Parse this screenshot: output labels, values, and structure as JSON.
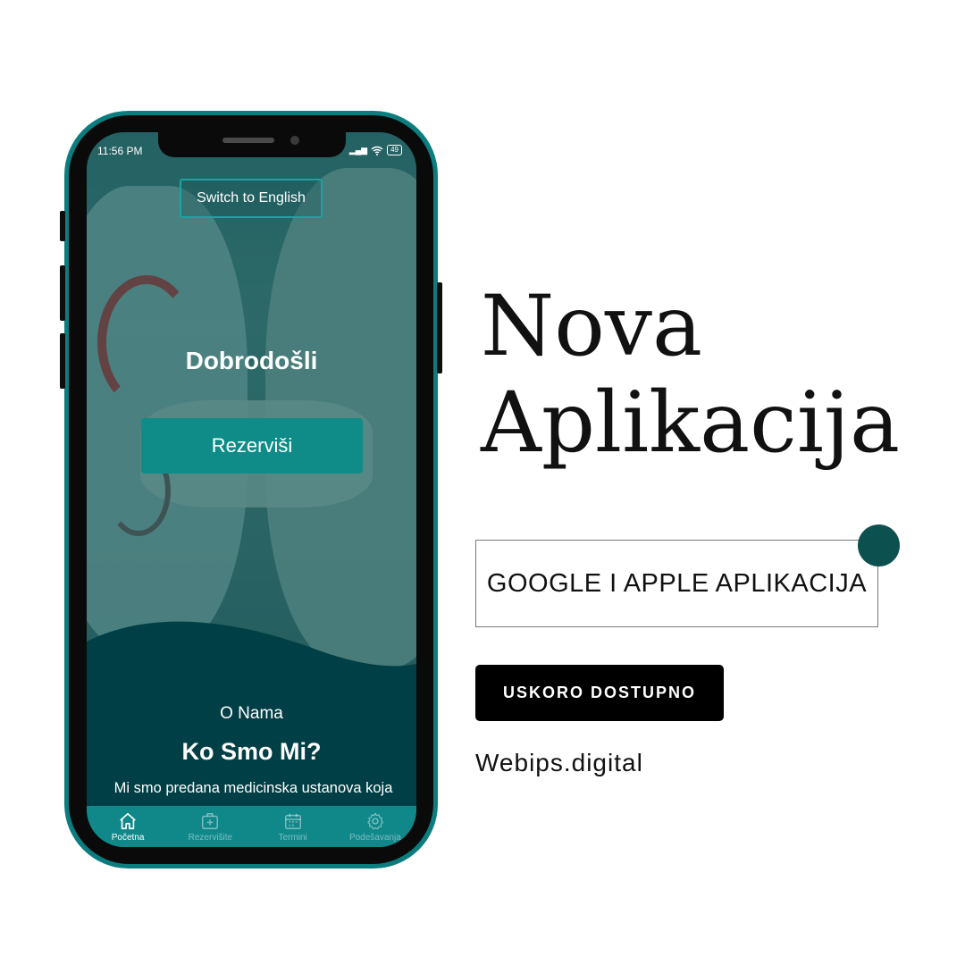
{
  "status_bar": {
    "time": "11:56 PM",
    "battery": "49"
  },
  "app": {
    "language_button": "Switch to English",
    "welcome_title": "Dobrodošli",
    "reserve_button": "Rezerviši",
    "about_label": "O Nama",
    "about_title": "Ko Smo Mi?",
    "about_text": "Mi smo predana medicinska ustanova koja",
    "tabs": [
      {
        "label": "Početna",
        "icon": "home-icon"
      },
      {
        "label": "Rezervišite",
        "icon": "plus-box-icon"
      },
      {
        "label": "Termini",
        "icon": "calendar-icon"
      },
      {
        "label": "Podešavanja",
        "icon": "gear-icon"
      }
    ]
  },
  "promo": {
    "headline_line1": "Nova",
    "headline_line2": "Aplikacija",
    "platforms": "GOOGLE I APPLE APLIKACIJA",
    "cta": "USKORO DOSTUPNO",
    "website": "Webips.digital"
  },
  "colors": {
    "accent": "#0f8b88",
    "frame": "#0b7d7f",
    "dark_teal": "#003f45",
    "dot": "#0d5050"
  }
}
